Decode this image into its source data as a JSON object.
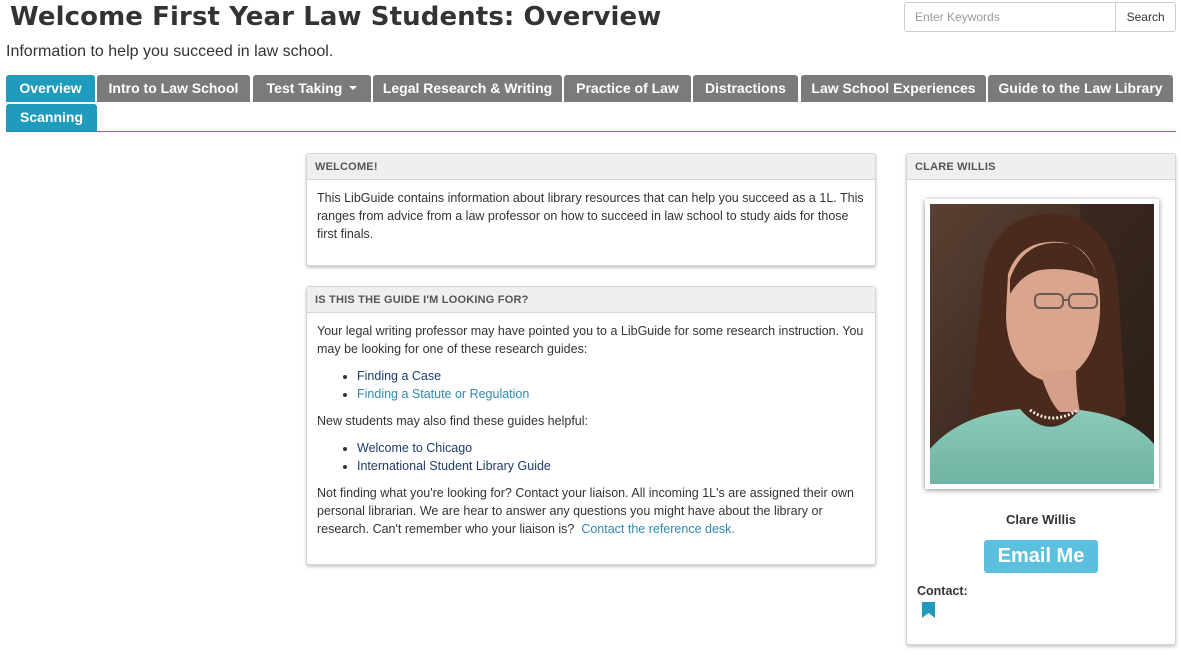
{
  "header": {
    "title": "Welcome First Year Law Students: Overview",
    "subtitle": "Information to help you succeed in law school."
  },
  "search": {
    "placeholder": "Enter Keywords",
    "value": "",
    "button_label": "Search"
  },
  "tabs": [
    {
      "label": "Overview",
      "active": true
    },
    {
      "label": "Intro to Law School"
    },
    {
      "label": "Test Taking",
      "dropdown": true
    },
    {
      "label": "Legal Research & Writing"
    },
    {
      "label": "Practice of Law"
    },
    {
      "label": "Distractions"
    },
    {
      "label": "Law School Experiences"
    },
    {
      "label": "Guide to the Law Library"
    },
    {
      "label": "Scanning"
    }
  ],
  "welcome_box": {
    "title": "Welcome!",
    "body": "This LibGuide contains information about library resources that can help you succeed as a 1L.  This ranges from advice from a law professor on how to succeed in law school to study aids for those first finals."
  },
  "guide_box": {
    "title": "Is this the guide I'm looking for?",
    "intro": "Your legal writing professor may have pointed you to a LibGuide for some research instruction.  You may be looking for one of these research guides:",
    "research_links": [
      "Finding a Case",
      "Finding a Statute or Regulation"
    ],
    "new_students_text": "New students may also find these guides helpful:",
    "new_student_links": [
      "Welcome to Chicago",
      "International Student Library Guide"
    ],
    "closing_text": "Not finding what you're looking for?  Contact your liaison.  All incoming 1L's are assigned their own personal librarian.  We are hear to answer any questions you might have about the library or research.  Can't remember who your liaison is?",
    "closing_link": "Contact the reference desk."
  },
  "profile_box": {
    "title": "Clare Willis",
    "name": "Clare Willis",
    "email_button": "Email Me",
    "contact_label": "Contact:",
    "photo_icon": "portrait-photo",
    "contact_icon": "bookmark-icon"
  },
  "colors": {
    "tab_active": "#1f9bbd",
    "tab_inactive": "#7b7b7b",
    "email_button": "#5bc0de",
    "link_dark": "#1d3b6c",
    "link_light": "#2e8ab3"
  }
}
